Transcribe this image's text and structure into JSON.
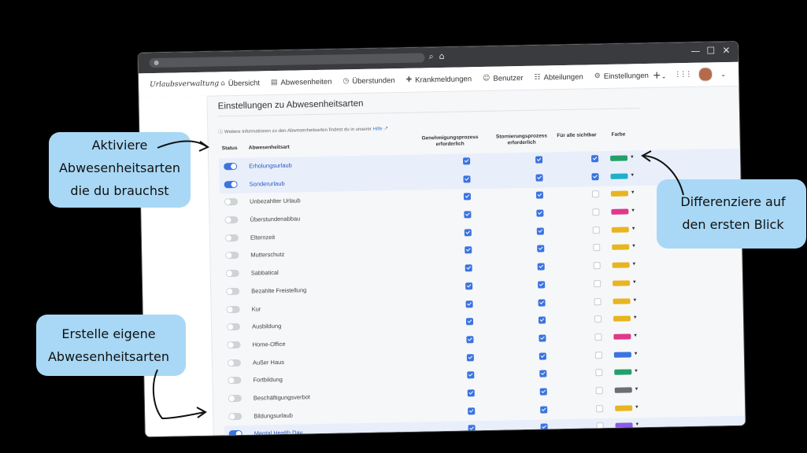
{
  "browser": {
    "search_icon": "search-icon",
    "home_icon": "home-icon"
  },
  "window_controls": {
    "minimize": "—",
    "maximize": "☐",
    "close": "✕"
  },
  "app": {
    "brand": "Urlaubsverwaltung"
  },
  "nav": [
    {
      "label": "Übersicht",
      "icon": "⌂"
    },
    {
      "label": "Abwesenheiten",
      "icon": "▤"
    },
    {
      "label": "Überstunden",
      "icon": "◷"
    },
    {
      "label": "Krankmeldungen",
      "icon": "✚"
    },
    {
      "label": "Benutzer",
      "icon": "☺"
    },
    {
      "label": "Abteilungen",
      "icon": "☷"
    },
    {
      "label": "Einstellungen",
      "icon": "⚙"
    }
  ],
  "nav_right": {
    "plus": "+",
    "plus_caret": "⌄",
    "apps": "⋮⋮⋮",
    "avatar_caret": "⌄"
  },
  "page": {
    "title": "Einstellungen zu Abwesenheitsarten",
    "info_text": "Weitere Informationen zu den Abwesenheitsarten findest du in unserer",
    "info_link": "Hilfe"
  },
  "table": {
    "headers": {
      "status": "Status",
      "name": "Abwesenheitsart",
      "approval_1": "Genehmigungsprozess",
      "approval_2": "erforderlich",
      "cancel_1": "Stornierungsprozess",
      "cancel_2": "erforderlich",
      "visible": "Für alle sichtbar",
      "color": "Farbe"
    },
    "rows": [
      {
        "name": "Erholungsurlaub",
        "active": true,
        "approval": true,
        "cancel": true,
        "visible": true,
        "color": "#22a06b"
      },
      {
        "name": "Sonderurlaub",
        "active": true,
        "approval": true,
        "cancel": true,
        "visible": true,
        "color": "#1fb1c9"
      },
      {
        "name": "Unbezahlter Urlaub",
        "active": false,
        "approval": true,
        "cancel": true,
        "visible": false,
        "color": "#e8b520"
      },
      {
        "name": "Überstundenabbau",
        "active": false,
        "approval": true,
        "cancel": true,
        "visible": false,
        "color": "#e0388a"
      },
      {
        "name": "Elternzeit",
        "active": false,
        "approval": true,
        "cancel": true,
        "visible": false,
        "color": "#e8b520"
      },
      {
        "name": "Mutterschutz",
        "active": false,
        "approval": true,
        "cancel": true,
        "visible": false,
        "color": "#e8b520"
      },
      {
        "name": "Sabbatical",
        "active": false,
        "approval": true,
        "cancel": true,
        "visible": false,
        "color": "#e8b520"
      },
      {
        "name": "Bezahlte Freistellung",
        "active": false,
        "approval": true,
        "cancel": true,
        "visible": false,
        "color": "#e8b520"
      },
      {
        "name": "Kur",
        "active": false,
        "approval": true,
        "cancel": true,
        "visible": false,
        "color": "#e8b520"
      },
      {
        "name": "Ausbildung",
        "active": false,
        "approval": true,
        "cancel": true,
        "visible": false,
        "color": "#e8b520"
      },
      {
        "name": "Home-Office",
        "active": false,
        "approval": true,
        "cancel": true,
        "visible": false,
        "color": "#e0388a"
      },
      {
        "name": "Außer Haus",
        "active": false,
        "approval": true,
        "cancel": true,
        "visible": false,
        "color": "#3b73e0"
      },
      {
        "name": "Fortbildung",
        "active": false,
        "approval": true,
        "cancel": true,
        "visible": false,
        "color": "#22a06b"
      },
      {
        "name": "Beschäftigungsverbot",
        "active": false,
        "approval": true,
        "cancel": true,
        "visible": false,
        "color": "#6b6e73"
      },
      {
        "name": "Bildungsurlaub",
        "active": false,
        "approval": true,
        "cancel": true,
        "visible": false,
        "color": "#e8b520"
      },
      {
        "name": "Mental Health Day",
        "active": true,
        "approval": true,
        "cancel": true,
        "visible": false,
        "color": "#8a5ce6"
      }
    ],
    "caret": "▾"
  },
  "callouts": {
    "left_top": [
      "Aktiviere",
      "Abwesenheitsarten",
      "die du brauchst"
    ],
    "right": [
      "Differenziere auf",
      "den ersten Blick"
    ],
    "left_bottom": [
      "Erstelle eigene",
      "Abwesenheitsarten"
    ]
  }
}
